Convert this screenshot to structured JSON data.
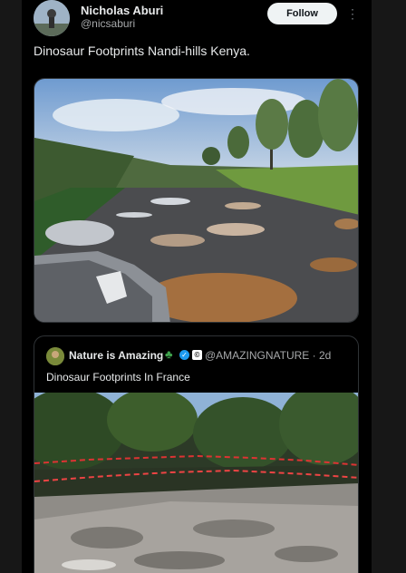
{
  "author": {
    "name": "Nicholas Aburi",
    "handle": "@nicsaburi",
    "follow_label": "Follow",
    "more_icon": "more-vertical-icon"
  },
  "post": {
    "text": "Dinosaur Footprints Nandi-hills Kenya."
  },
  "quoted_post": {
    "name": "Nature is Amazing",
    "emoji_icon": "sprout-icon",
    "verified_icon": "verified-badge-icon",
    "affiliate_icon": "copyright-badge-icon",
    "handle_time": "@AMAZINGNATURE · 2d",
    "text": "Dinosaur Footprints In France"
  },
  "colors": {
    "background": "#000000",
    "follow_button": "#eff3f4",
    "verified": "#1d9bf0"
  }
}
